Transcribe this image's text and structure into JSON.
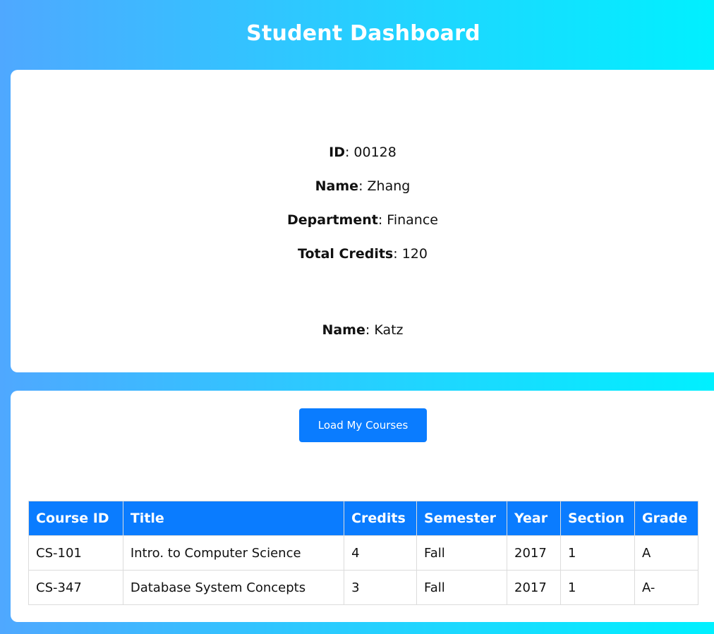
{
  "header": {
    "title": "Student Dashboard"
  },
  "profile": {
    "id_label": "ID",
    "id_value": "00128",
    "name_label": "Name",
    "name_value": "Zhang",
    "department_label": "Department",
    "department_value": "Finance",
    "credits_label": "Total Credits",
    "credits_value": "120",
    "advisor_name_label": "Name",
    "advisor_name_value": "Katz"
  },
  "courses": {
    "load_button_label": "Load My Courses",
    "columns": [
      "Course ID",
      "Title",
      "Credits",
      "Semester",
      "Year",
      "Section",
      "Grade"
    ],
    "rows": [
      [
        "CS-101",
        "Intro. to Computer Science",
        "4",
        "Fall",
        "2017",
        "1",
        "A"
      ],
      [
        "CS-347",
        "Database System Concepts",
        "3",
        "Fall",
        "2017",
        "1",
        "A-"
      ]
    ]
  },
  "colors": {
    "accent": "#0a7cff",
    "background_start": "#4fa8ff",
    "background_end": "#00f0ff"
  }
}
